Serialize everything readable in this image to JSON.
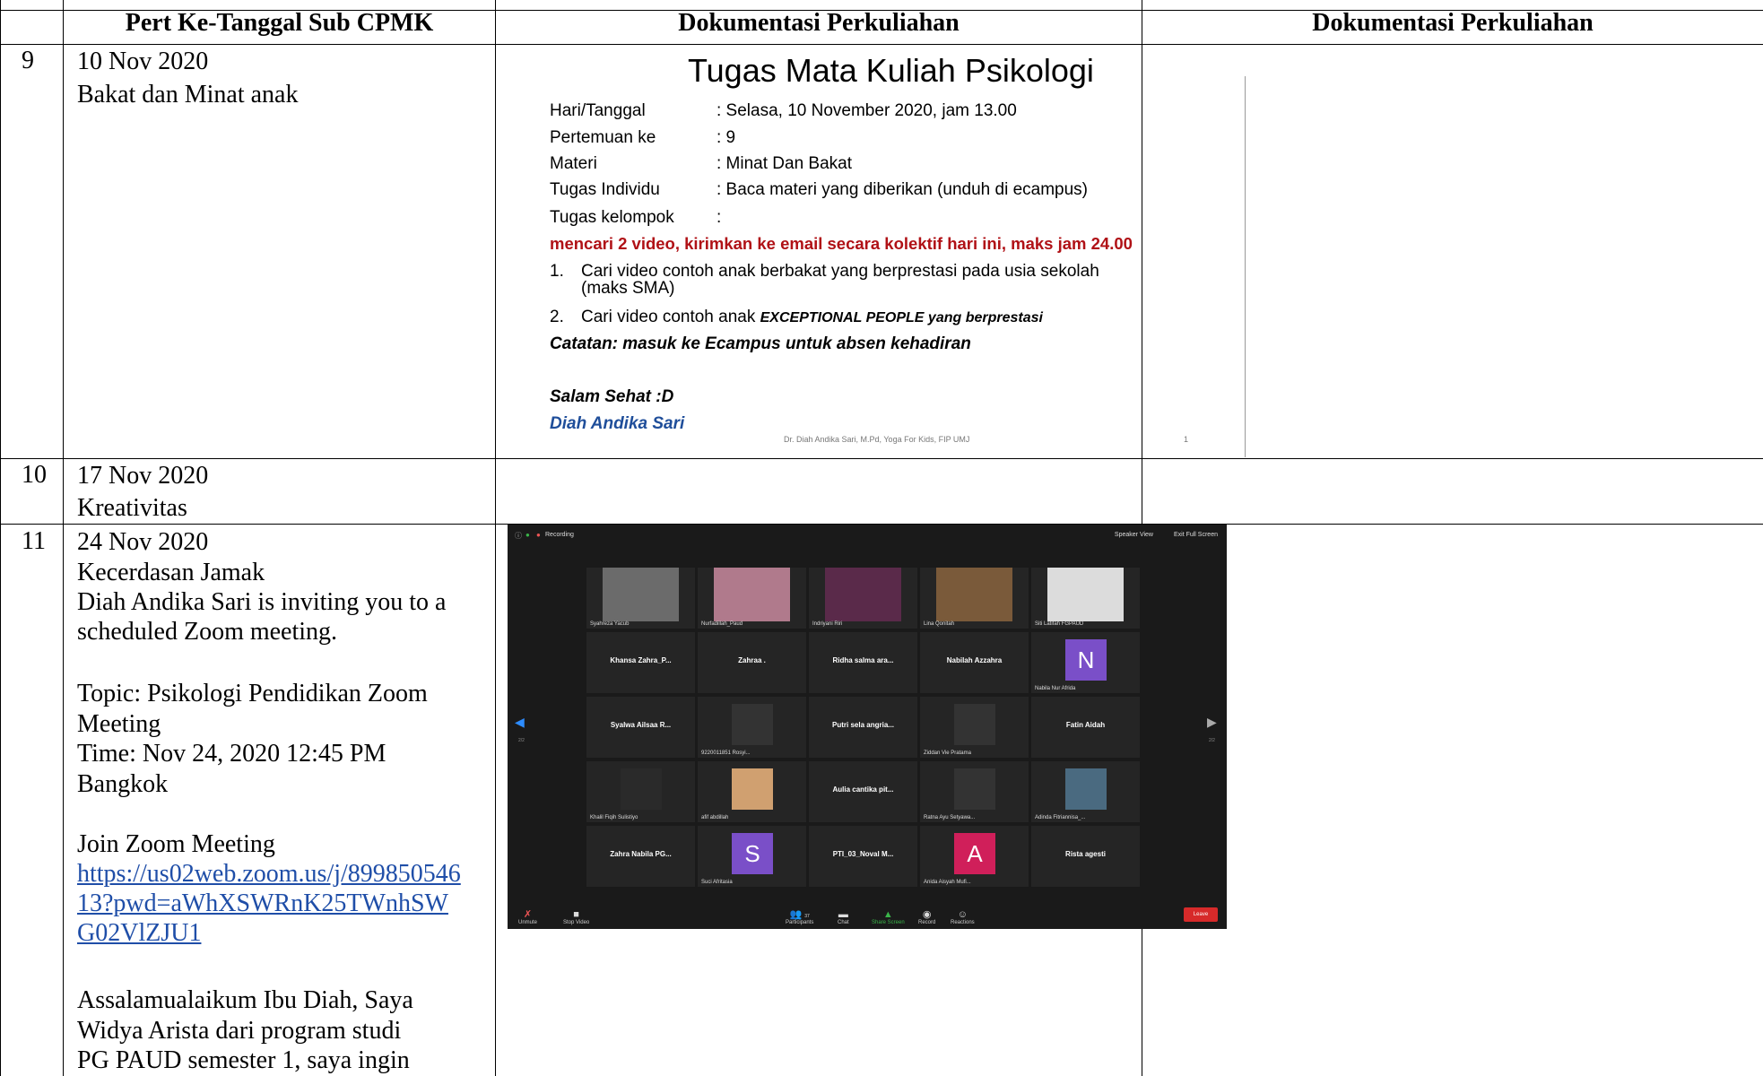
{
  "headers": {
    "col2": "Pert Ke-Tanggal Sub CPMK",
    "col3": "Dokumentasi Perkuliahan",
    "col4": "Dokumentasi Perkuliahan"
  },
  "rows": [
    {
      "number": "9",
      "date": "10 Nov 2020",
      "topic": "Bakat dan Minat anak"
    },
    {
      "number": "10",
      "date": "17 Nov 2020",
      "topic": "Kreativitas"
    },
    {
      "number": "11",
      "date": "24 Nov 2020",
      "topic": "Kecerdasan Jamak",
      "invite_line1": "Diah Andika Sari is inviting you to a",
      "invite_line2": "scheduled Zoom meeting.",
      "topic_line1": "Topic: Psikologi Pendidikan Zoom",
      "topic_line2": "Meeting",
      "time_line1": "Time: Nov 24, 2020 12:45 PM",
      "time_line2": "Bangkok",
      "join_label": "Join Zoom Meeting",
      "link_line1": "https://us02web.zoom.us/j/899850546",
      "link_line2": "13?pwd=aWhXSWRnK25TWnhSW",
      "link_line3": "G02VlZJU1",
      "msg_line1": "Assalamualaikum Ibu Diah, Saya",
      "msg_line2": "Widya Arista dari program studi",
      "msg_line3": "PG PAUD semester 1, saya ingin"
    }
  ],
  "slide": {
    "title": "Tugas Mata Kuliah Psikologi",
    "fields": [
      {
        "label": "Hari/Tanggal",
        "value": ": Selasa, 10 November 2020, jam 13.00"
      },
      {
        "label": "Pertemuan ke",
        "value": ": 9"
      },
      {
        "label": "Materi",
        "value": ": Minat Dan Bakat"
      },
      {
        "label": "Tugas Individu",
        "value": ": Baca materi yang diberikan (unduh di ecampus)"
      },
      {
        "label": "Tugas  kelompok",
        "value": ":"
      }
    ],
    "red_line": "mencari 2 video, kirimkan ke email secara kolektif hari ini, maks jam 24.00",
    "item1_num": "1.",
    "item1_line1": "Cari video contoh anak berbakat yang berprestasi pada usia sekolah",
    "item1_line2": "(maks SMA)",
    "item2_num": "2.",
    "item2_prefix": "Cari video contoh anak ",
    "item2_em": "EXCEPTIONAL PEOPLE yang berprestasi",
    "catatan": "Catatan: masuk ke Ecampus untuk absen kehadiran",
    "salam": "Salam Sehat :D",
    "signature": "Diah Andika Sari",
    "footer": "Dr. Diah Andika Sari, M.Pd, Yoga For Kids, FIP UMJ",
    "page_number": "1"
  },
  "zoom": {
    "recording": "Recording",
    "speaker_view": "Speaker View",
    "exit_full": "Exit Full Screen",
    "page_left": "2/2",
    "page_right": "2/2",
    "tiles": [
      {
        "name": "",
        "label": "Syahreza Yacub",
        "kind": "video"
      },
      {
        "name": "",
        "label": "Nurfadillah_Paud",
        "kind": "video"
      },
      {
        "name": "",
        "label": "Indriyani Riri",
        "kind": "video"
      },
      {
        "name": "",
        "label": "Lina Qonitah",
        "kind": "video"
      },
      {
        "name": "",
        "label": "Siti Latifah FGPAUD",
        "kind": "video"
      },
      {
        "name": "Khansa Zahra_P...",
        "label": "",
        "kind": "name"
      },
      {
        "name": "Zahraa .",
        "label": "",
        "kind": "name"
      },
      {
        "name": "Ridha salma ara...",
        "label": "",
        "kind": "name"
      },
      {
        "name": "Nabilah Azzahra",
        "label": "",
        "kind": "name"
      },
      {
        "name": "",
        "label": "Nabila Nur Afrida",
        "kind": "letter",
        "letter": "N",
        "color": "#7a4fc8"
      },
      {
        "name": "Syalwa Ailsaa R...",
        "label": "",
        "kind": "name"
      },
      {
        "name": "",
        "label": "9220011851 Rosyi...",
        "kind": "video"
      },
      {
        "name": "Putri sela angria...",
        "label": "",
        "kind": "name"
      },
      {
        "name": "",
        "label": "Ziddan Vie Pratama",
        "kind": "video"
      },
      {
        "name": "Fatin Aidah",
        "label": "",
        "kind": "name"
      },
      {
        "name": "",
        "label": "Khalil Fiqih Sulistiyo",
        "kind": "video"
      },
      {
        "name": "",
        "label": "afif abdillah",
        "kind": "video"
      },
      {
        "name": "Aulia cantika pit...",
        "label": "",
        "kind": "name"
      },
      {
        "name": "",
        "label": "Ratna Ayu Setyawa...",
        "kind": "video"
      },
      {
        "name": "",
        "label": "Adinda Fitriannisa_...",
        "kind": "video"
      },
      {
        "name": "Zahra Nabila PG...",
        "label": "",
        "kind": "name"
      },
      {
        "name": "",
        "label": "Suci Afritasia",
        "kind": "letter",
        "letter": "S",
        "color": "#7a4fc8"
      },
      {
        "name": "PTI_03_Noval M...",
        "label": "",
        "kind": "name"
      },
      {
        "name": "",
        "label": "Anida Aisyah Mufi...",
        "kind": "letter",
        "letter": "A",
        "color": "#d01f5a"
      },
      {
        "name": "Rista agesti",
        "label": "",
        "kind": "name"
      }
    ],
    "toolbar": {
      "unmute": "Unmute",
      "stop_video": "Stop Video",
      "participants": "Participants",
      "participants_count": "37",
      "chat": "Chat",
      "share_screen": "Share Screen",
      "record": "Record",
      "reactions": "Reactions",
      "leave": "Leave"
    }
  }
}
